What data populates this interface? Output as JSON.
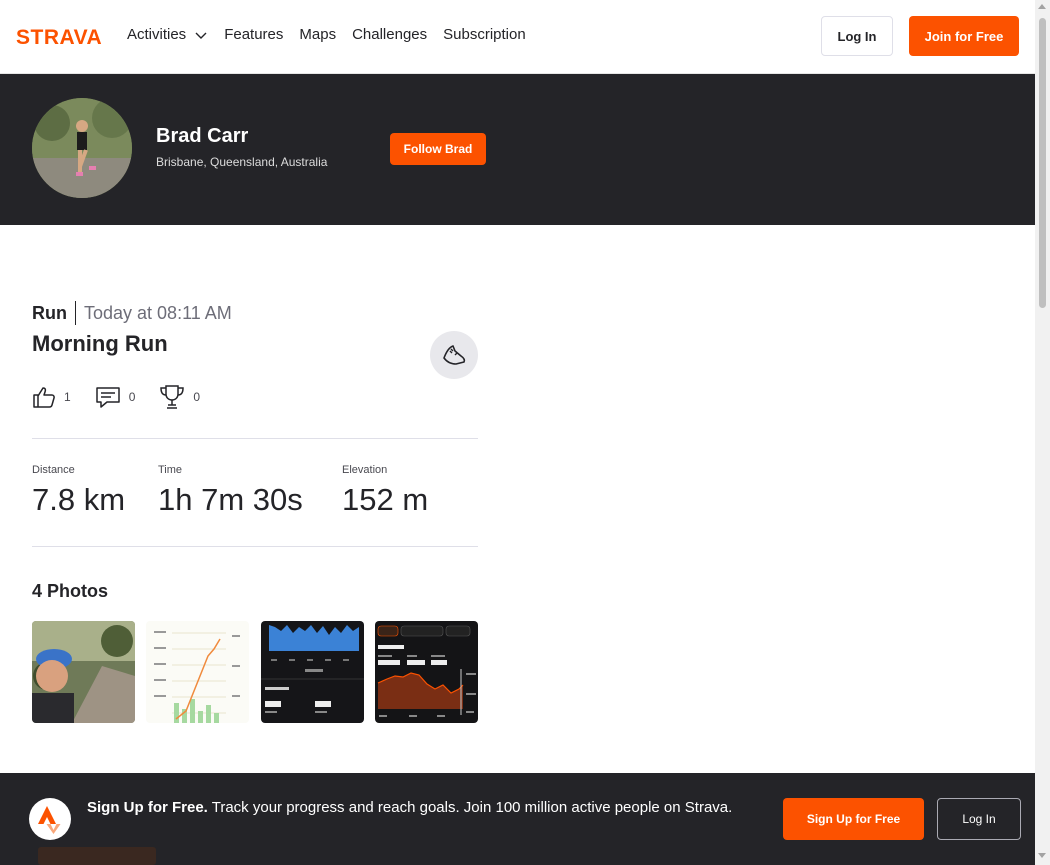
{
  "brand": {
    "name": "STRAVA",
    "accent": "#fc5200"
  },
  "nav": {
    "links": [
      "Activities",
      "Features",
      "Maps",
      "Challenges",
      "Subscription"
    ],
    "login_label": "Log In",
    "join_label": "Join for Free"
  },
  "athlete": {
    "name": "Brad Carr",
    "location": "Brisbane, Queensland, Australia",
    "follow_label": "Follow Brad"
  },
  "activity": {
    "type": "Run",
    "time": "Today at 08:11 AM",
    "name": "Morning Run",
    "kudos": "1",
    "comments": "0",
    "achievements": "0",
    "stats": [
      {
        "label": "Distance",
        "value": "7.8 km"
      },
      {
        "label": "Time",
        "value": "1h 7m 30s"
      },
      {
        "label": "Elevation",
        "value": "152 m"
      }
    ],
    "photos_title": "4 Photos"
  },
  "banner": {
    "bold": "Sign Up for Free.",
    "text": " Track your progress and reach goals. Join 100 million active people on Strava.",
    "signup_label": "Sign Up for Free",
    "login_label": "Log In"
  }
}
